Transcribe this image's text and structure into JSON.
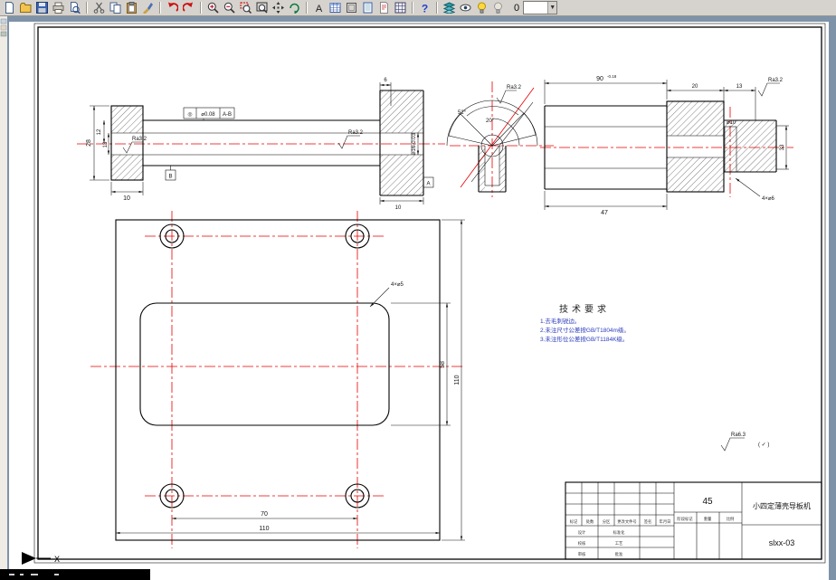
{
  "app": {
    "window_bg": "#7e93a8",
    "toolbar_bg": "#d6d3ce",
    "sheet_color": "#ffffff",
    "line_color": "#000000",
    "centerline_color": "#e60000"
  },
  "toolbar": {
    "icons": [
      "new-icon",
      "open-icon",
      "save-icon",
      "print-icon",
      "print-preview-icon",
      "cut-icon",
      "copy-icon",
      "paste-icon",
      "format-brush-icon",
      "undo-icon",
      "redo-icon",
      "zoom-in-icon",
      "zoom-out-icon",
      "zoom-window-icon",
      "zoom-all-icon",
      "pan-icon",
      "regen-icon",
      "text-style-icon",
      "table-icon",
      "frame-icon",
      "notebook-icon",
      "markup-icon",
      "grid-icon",
      "help-icon",
      "layers-icon",
      "visibility-icon",
      "bulb-on-icon",
      "bulb-off-icon"
    ],
    "layer_value": "0"
  },
  "views": {
    "sleeve": {
      "d28": "28",
      "d12": "12",
      "d13": "13",
      "d10_left": "10",
      "d10_right": "10",
      "d6": "6",
      "phi16": "⌀16-0.03",
      "ra_bore": "Ra3.2",
      "ra_face": "Ra3.2",
      "fcf_sym": "◎",
      "fcf_tol": "⌀0.08",
      "fcf_datum": "A-B",
      "datum_a": "A",
      "datum_b": "B"
    },
    "angled": {
      "ra": "Ra3.2",
      "angle1": "52°",
      "angle2": "20°"
    },
    "shaft": {
      "d90": "90",
      "d90_tol": "-0.18",
      "d20": "20",
      "d13": "13",
      "ra": "Ra3.2",
      "phi10": "⌀10",
      "d33": "33",
      "d47": "47",
      "d4x6": "4×⌀6"
    },
    "plate": {
      "d4x5": "4×⌀5",
      "d58": "58",
      "d110_right": "110",
      "d70": "70",
      "d110_bottom": "110"
    }
  },
  "tech_req": {
    "title": "技术要求",
    "items": [
      "1.去毛刺锐边。",
      "2.未注尺寸公差按GB/T1804m级。",
      "3.未注形位公差按GB/T1184K级。"
    ]
  },
  "finish_note": {
    "ra": "Ra6.3",
    "rest": "( ✓ )"
  },
  "title_block": {
    "material": "45",
    "part_name": "小四定薄壳导板机",
    "drawing_no": "slxx-03",
    "labels": {
      "mark": "标记",
      "count": "处数",
      "zone": "分区",
      "change_file": "更改文件号",
      "sign": "签名",
      "date": "年月日",
      "design": "设计",
      "check": "校核",
      "review": "审核",
      "standard": "标准化",
      "process": "工艺",
      "approve": "批准",
      "stage": "阶段标记",
      "weight": "重量",
      "scale": "比例"
    }
  },
  "ucs": {
    "x_label": "X"
  }
}
